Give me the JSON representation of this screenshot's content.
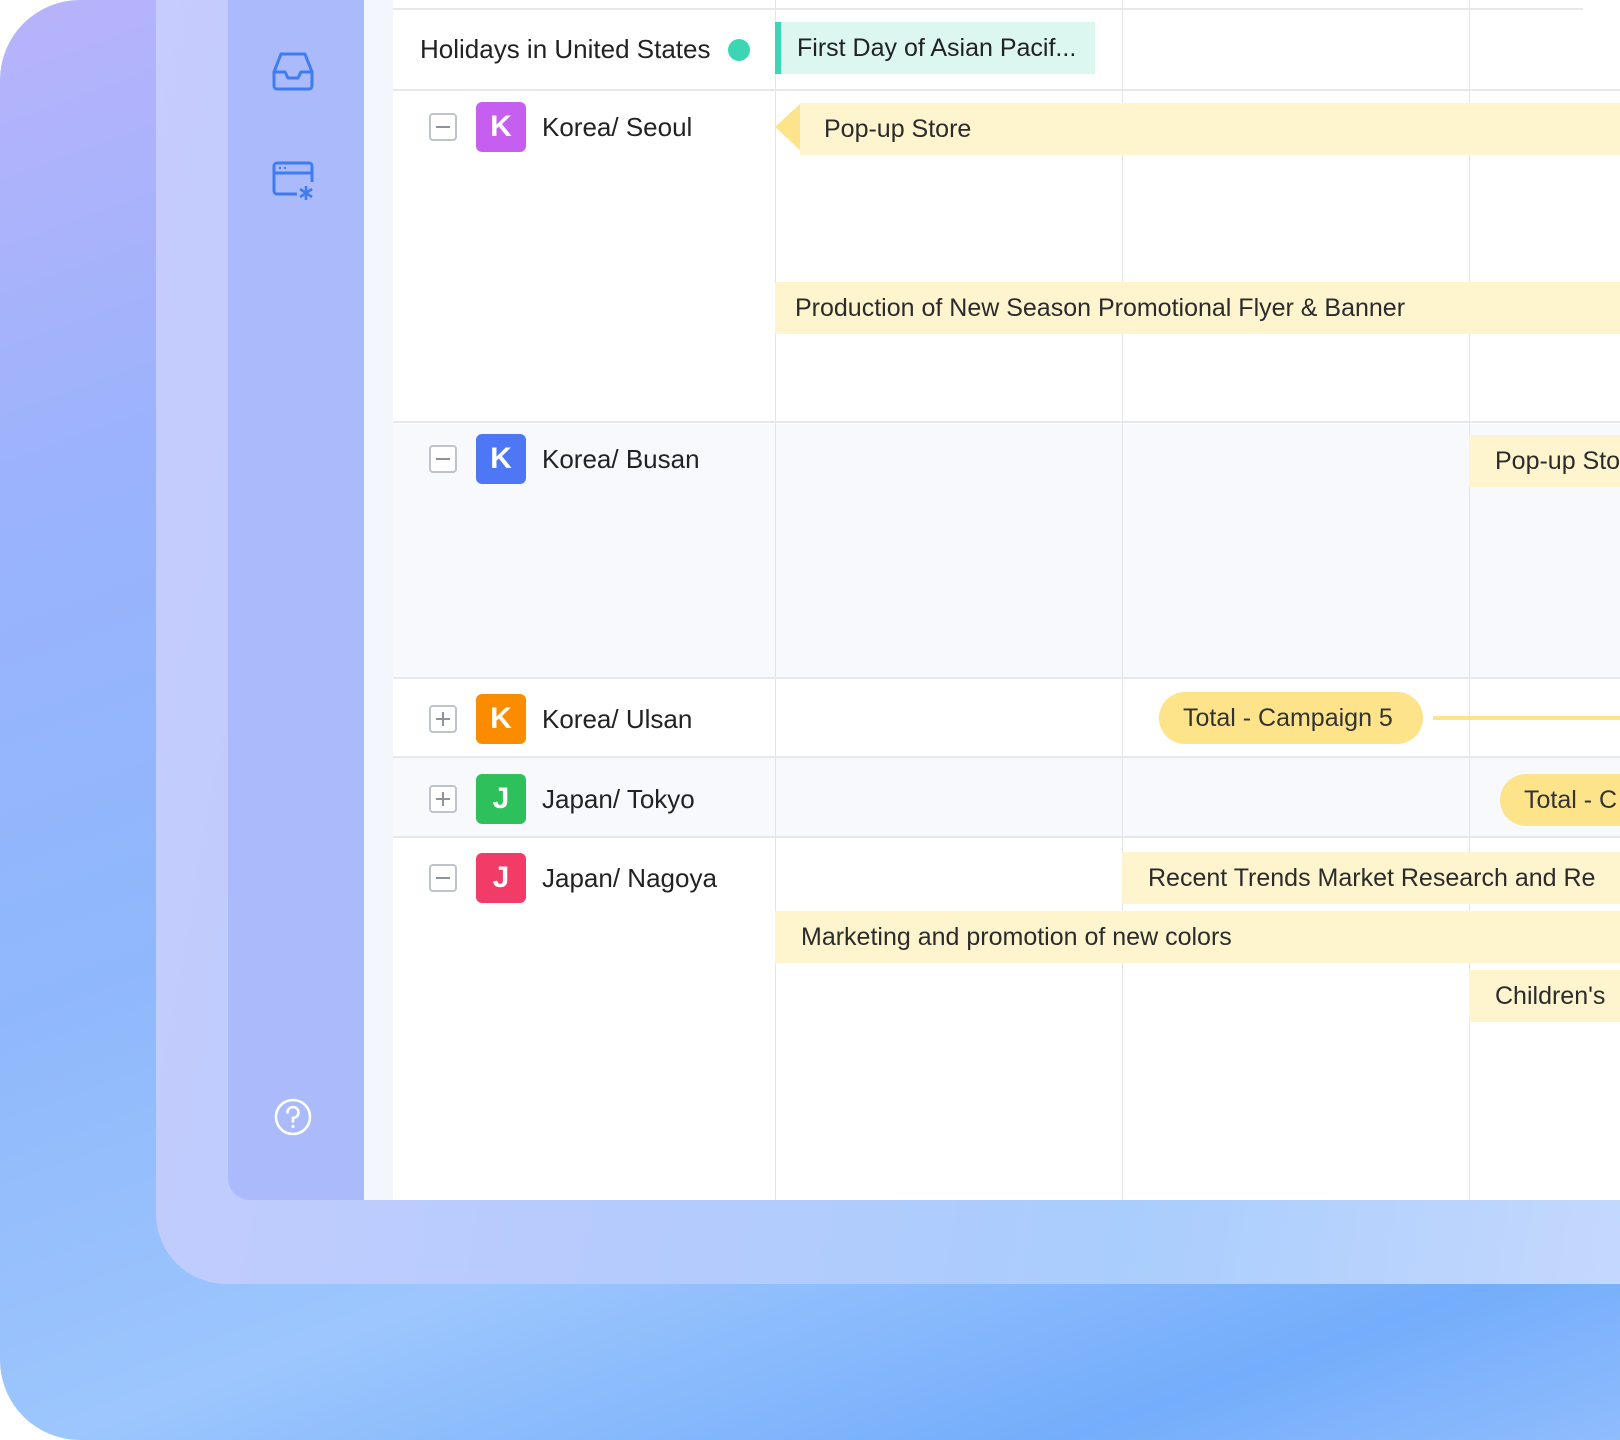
{
  "sidebar": {
    "icons": [
      {
        "name": "inbox-icon"
      },
      {
        "name": "calendar-settings-icon"
      },
      {
        "name": "help-icon"
      }
    ]
  },
  "holidays": {
    "label": "Holidays in United States",
    "dot_color": "#3dd6b4",
    "event": "First Day of Asian Pacif..."
  },
  "rows": [
    {
      "letter": "K",
      "name": "Korea/ Seoul",
      "color": "#c65ef0",
      "expanded": true
    },
    {
      "letter": "K",
      "name": "Korea/ Busan",
      "color": "#4d77f5",
      "expanded": true
    },
    {
      "letter": "K",
      "name": "Korea/ Ulsan",
      "color": "#fb8c00",
      "expanded": false
    },
    {
      "letter": "J",
      "name": "Japan/ Tokyo",
      "color": "#2ec05a",
      "expanded": false
    },
    {
      "letter": "J",
      "name": "Japan/ Nagoya",
      "color": "#f23b66",
      "expanded": true
    }
  ],
  "events": {
    "seoul_popup": "Pop-up Store",
    "seoul_flyer": "Production of New Season Promotional Flyer & Banner",
    "busan_popup": "Pop-up Sto",
    "ulsan_campaign": "Total - Campaign 5",
    "tokyo_campaign": "Total - C",
    "nagoya_research": "Recent Trends Market Research and Re",
    "nagoya_marketing": "Marketing and promotion of new colors",
    "nagoya_children": "Children's"
  },
  "colors": {
    "event_bar": "#fef5cf",
    "campaign_pill": "#fde38a",
    "sidebar": "#abbafb",
    "icon": "#3f7cf0"
  }
}
